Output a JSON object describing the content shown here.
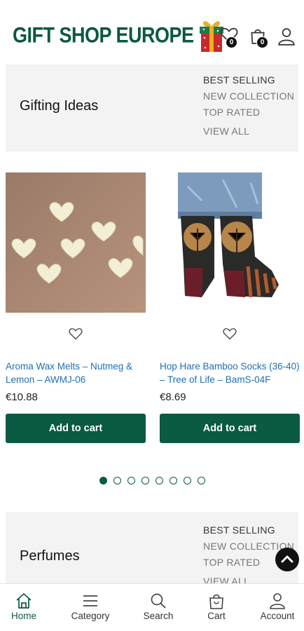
{
  "header": {
    "logo_text": "GIFT SHOP EUROPE",
    "wishlist_count": "0",
    "cart_count": "0"
  },
  "sections": [
    {
      "title": "Gifting Ideas",
      "links": [
        "BEST SELLING",
        "NEW COLLECTION",
        "TOP RATED",
        "VIEW ALL"
      ]
    },
    {
      "title": "Perfumes",
      "links": [
        "BEST SELLING",
        "NEW COLLECTION",
        "TOP RATED",
        "VIEW ALL"
      ]
    }
  ],
  "products": [
    {
      "name": "Aroma Wax Melts – Nutmeg & Lemon – AWMJ-06",
      "price": "€10.88",
      "button": "Add to cart"
    },
    {
      "name": "Hop Hare Bamboo Socks (36-40) – Tree of Life – BamS-04F",
      "price": "€8.69",
      "button": "Add to cart"
    }
  ],
  "carousel": {
    "page_count": 8,
    "active_page": 1
  },
  "bottom_nav": [
    {
      "label": "Home",
      "icon": "home-icon",
      "active": true
    },
    {
      "label": "Category",
      "icon": "menu-icon",
      "active": false
    },
    {
      "label": "Search",
      "icon": "search-icon",
      "active": false
    },
    {
      "label": "Cart",
      "icon": "cart-icon",
      "active": false
    },
    {
      "label": "Account",
      "icon": "user-icon",
      "active": false
    }
  ],
  "colors": {
    "brand_green": "#0b5a43",
    "link_blue": "#1e6fb8",
    "section_bg": "#f3f3f3"
  }
}
